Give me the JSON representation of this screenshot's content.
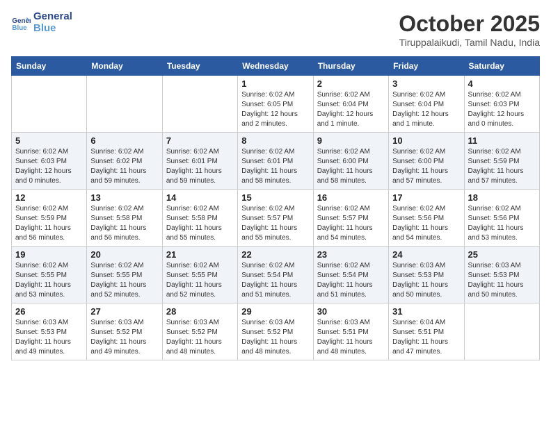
{
  "header": {
    "logo_line1": "General",
    "logo_line2": "Blue",
    "month": "October 2025",
    "location": "Tiruppalaikudi, Tamil Nadu, India"
  },
  "weekdays": [
    "Sunday",
    "Monday",
    "Tuesday",
    "Wednesday",
    "Thursday",
    "Friday",
    "Saturday"
  ],
  "weeks": [
    [
      {
        "day": "",
        "info": ""
      },
      {
        "day": "",
        "info": ""
      },
      {
        "day": "",
        "info": ""
      },
      {
        "day": "1",
        "info": "Sunrise: 6:02 AM\nSunset: 6:05 PM\nDaylight: 12 hours\nand 2 minutes."
      },
      {
        "day": "2",
        "info": "Sunrise: 6:02 AM\nSunset: 6:04 PM\nDaylight: 12 hours\nand 1 minute."
      },
      {
        "day": "3",
        "info": "Sunrise: 6:02 AM\nSunset: 6:04 PM\nDaylight: 12 hours\nand 1 minute."
      },
      {
        "day": "4",
        "info": "Sunrise: 6:02 AM\nSunset: 6:03 PM\nDaylight: 12 hours\nand 0 minutes."
      }
    ],
    [
      {
        "day": "5",
        "info": "Sunrise: 6:02 AM\nSunset: 6:03 PM\nDaylight: 12 hours\nand 0 minutes."
      },
      {
        "day": "6",
        "info": "Sunrise: 6:02 AM\nSunset: 6:02 PM\nDaylight: 11 hours\nand 59 minutes."
      },
      {
        "day": "7",
        "info": "Sunrise: 6:02 AM\nSunset: 6:01 PM\nDaylight: 11 hours\nand 59 minutes."
      },
      {
        "day": "8",
        "info": "Sunrise: 6:02 AM\nSunset: 6:01 PM\nDaylight: 11 hours\nand 58 minutes."
      },
      {
        "day": "9",
        "info": "Sunrise: 6:02 AM\nSunset: 6:00 PM\nDaylight: 11 hours\nand 58 minutes."
      },
      {
        "day": "10",
        "info": "Sunrise: 6:02 AM\nSunset: 6:00 PM\nDaylight: 11 hours\nand 57 minutes."
      },
      {
        "day": "11",
        "info": "Sunrise: 6:02 AM\nSunset: 5:59 PM\nDaylight: 11 hours\nand 57 minutes."
      }
    ],
    [
      {
        "day": "12",
        "info": "Sunrise: 6:02 AM\nSunset: 5:59 PM\nDaylight: 11 hours\nand 56 minutes."
      },
      {
        "day": "13",
        "info": "Sunrise: 6:02 AM\nSunset: 5:58 PM\nDaylight: 11 hours\nand 56 minutes."
      },
      {
        "day": "14",
        "info": "Sunrise: 6:02 AM\nSunset: 5:58 PM\nDaylight: 11 hours\nand 55 minutes."
      },
      {
        "day": "15",
        "info": "Sunrise: 6:02 AM\nSunset: 5:57 PM\nDaylight: 11 hours\nand 55 minutes."
      },
      {
        "day": "16",
        "info": "Sunrise: 6:02 AM\nSunset: 5:57 PM\nDaylight: 11 hours\nand 54 minutes."
      },
      {
        "day": "17",
        "info": "Sunrise: 6:02 AM\nSunset: 5:56 PM\nDaylight: 11 hours\nand 54 minutes."
      },
      {
        "day": "18",
        "info": "Sunrise: 6:02 AM\nSunset: 5:56 PM\nDaylight: 11 hours\nand 53 minutes."
      }
    ],
    [
      {
        "day": "19",
        "info": "Sunrise: 6:02 AM\nSunset: 5:55 PM\nDaylight: 11 hours\nand 53 minutes."
      },
      {
        "day": "20",
        "info": "Sunrise: 6:02 AM\nSunset: 5:55 PM\nDaylight: 11 hours\nand 52 minutes."
      },
      {
        "day": "21",
        "info": "Sunrise: 6:02 AM\nSunset: 5:55 PM\nDaylight: 11 hours\nand 52 minutes."
      },
      {
        "day": "22",
        "info": "Sunrise: 6:02 AM\nSunset: 5:54 PM\nDaylight: 11 hours\nand 51 minutes."
      },
      {
        "day": "23",
        "info": "Sunrise: 6:02 AM\nSunset: 5:54 PM\nDaylight: 11 hours\nand 51 minutes."
      },
      {
        "day": "24",
        "info": "Sunrise: 6:03 AM\nSunset: 5:53 PM\nDaylight: 11 hours\nand 50 minutes."
      },
      {
        "day": "25",
        "info": "Sunrise: 6:03 AM\nSunset: 5:53 PM\nDaylight: 11 hours\nand 50 minutes."
      }
    ],
    [
      {
        "day": "26",
        "info": "Sunrise: 6:03 AM\nSunset: 5:53 PM\nDaylight: 11 hours\nand 49 minutes."
      },
      {
        "day": "27",
        "info": "Sunrise: 6:03 AM\nSunset: 5:52 PM\nDaylight: 11 hours\nand 49 minutes."
      },
      {
        "day": "28",
        "info": "Sunrise: 6:03 AM\nSunset: 5:52 PM\nDaylight: 11 hours\nand 48 minutes."
      },
      {
        "day": "29",
        "info": "Sunrise: 6:03 AM\nSunset: 5:52 PM\nDaylight: 11 hours\nand 48 minutes."
      },
      {
        "day": "30",
        "info": "Sunrise: 6:03 AM\nSunset: 5:51 PM\nDaylight: 11 hours\nand 48 minutes."
      },
      {
        "day": "31",
        "info": "Sunrise: 6:04 AM\nSunset: 5:51 PM\nDaylight: 11 hours\nand 47 minutes."
      },
      {
        "day": "",
        "info": ""
      }
    ]
  ]
}
